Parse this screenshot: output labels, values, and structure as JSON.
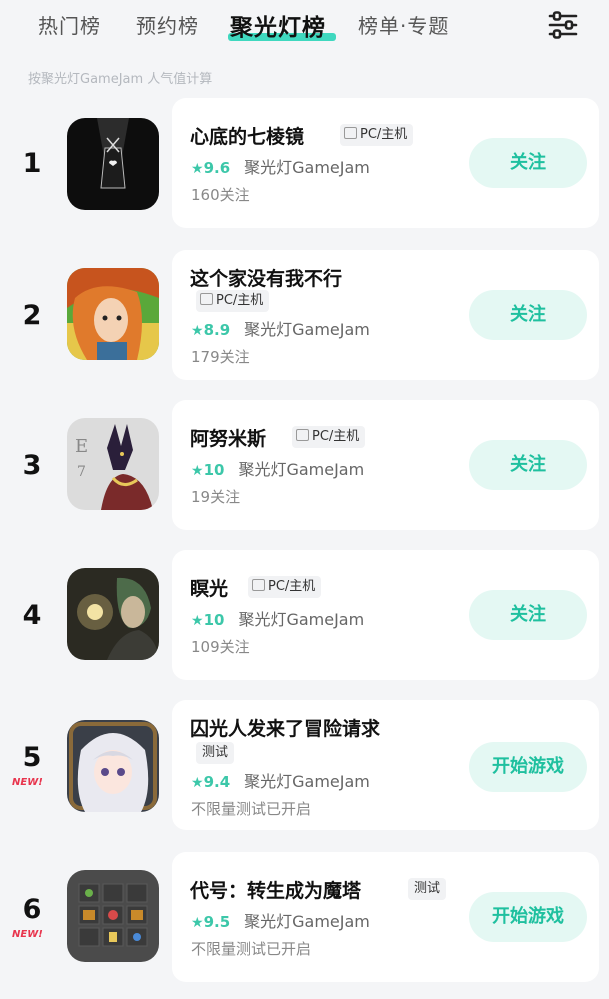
{
  "tabs": [
    {
      "label": "热门榜",
      "active": false
    },
    {
      "label": "预约榜",
      "active": false
    },
    {
      "label": "聚光灯榜",
      "active": true
    },
    {
      "label": "榜单·专题",
      "active": false
    }
  ],
  "filter_icon": "sliders-icon",
  "subtitle": "按聚光灯GameJam 人气值计算",
  "colors": {
    "accent": "#3cc7a9",
    "new_badge": "#e8344d",
    "button_bg": "#e4f8f3"
  },
  "items": [
    {
      "rank": "1",
      "new": "",
      "title": "心底的七棱镜",
      "tag": "PC/主机",
      "star": "★",
      "score": "9.6",
      "studio": "聚光灯GameJam",
      "meta": "160关注",
      "button": "关注"
    },
    {
      "rank": "2",
      "new": "",
      "title": "这个家没有我不行",
      "tag": "PC/主机",
      "star": "★",
      "score": "8.9",
      "studio": "聚光灯GameJam",
      "meta": "179关注",
      "button": "关注"
    },
    {
      "rank": "3",
      "new": "",
      "title": "阿努米斯",
      "tag": "PC/主机",
      "star": "★",
      "score": "10",
      "studio": "聚光灯GameJam",
      "meta": "19关注",
      "button": "关注"
    },
    {
      "rank": "4",
      "new": "",
      "title": "瞑光",
      "tag": "PC/主机",
      "star": "★",
      "score": "10",
      "studio": "聚光灯GameJam",
      "meta": "109关注",
      "button": "关注"
    },
    {
      "rank": "5",
      "new": "NEW!",
      "title": "囚光人发来了冒险请求",
      "tag": "测试",
      "star": "★",
      "score": "9.4",
      "studio": "聚光灯GameJam",
      "meta": "不限量测试已开启",
      "button": "开始游戏"
    },
    {
      "rank": "6",
      "new": "NEW!",
      "title": "代号：转生成为魔塔",
      "tag": "测试",
      "star": "★",
      "score": "9.5",
      "studio": "聚光灯GameJam",
      "meta": "不限量测试已开启",
      "button": "开始游戏"
    }
  ]
}
